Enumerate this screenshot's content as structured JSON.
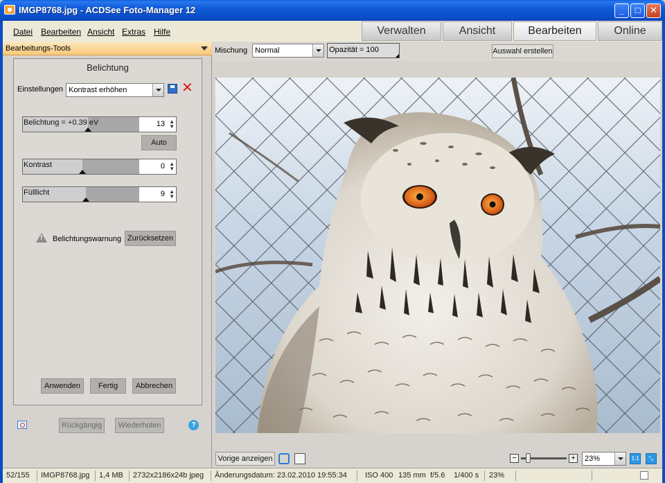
{
  "window": {
    "title": "IMGP8768.jpg - ACDSee Foto-Manager 12",
    "minimize": "_",
    "maximize": "□",
    "close": "✕"
  },
  "menu": [
    "Datei",
    "Bearbeiten",
    "Ansicht",
    "Extras",
    "Hilfe"
  ],
  "mode_tabs": [
    {
      "label": "Verwalten",
      "active": false
    },
    {
      "label": "Ansicht",
      "active": false
    },
    {
      "label": "Bearbeiten",
      "active": true
    },
    {
      "label": "Online",
      "active": false
    }
  ],
  "panel": {
    "header": "Bearbeitungs-Tools",
    "title": "Belichtung",
    "settings_label": "Einstellungen",
    "settings_value": "Kontrast erhöhen",
    "sliders": [
      {
        "label": "Belichtung = +0.39 eV",
        "value": "13",
        "level": 0.56
      },
      {
        "label": "Kontrast",
        "value": "0",
        "level": 0.51
      },
      {
        "label": "Fülllicht",
        "value": "9",
        "level": 0.54
      }
    ],
    "auto_button": "Auto",
    "warning_label": "Belichtungswarnung",
    "reset_button": "Zurücksetzen",
    "apply_button": "Anwenden",
    "done_button": "Fertig",
    "cancel_button": "Abbrechen",
    "undo_button": "Rückgängig",
    "redo_button": "Wiederholen",
    "help": "?"
  },
  "toolbar": {
    "blend_label": "Mischung",
    "blend_value": "Normal",
    "opacity": "Opazität = 100",
    "create_selection": "Auswahl erstellen"
  },
  "bottom_toolbar": {
    "show_previous": "Vorige anzeigen",
    "zoom": "23%",
    "zoom_level": 0.23,
    "actual_size": "1:1"
  },
  "statusbar": {
    "index": "52/155",
    "filename": "IMGP8768.jpg",
    "filesize": "1,4 MB",
    "dimensions": "2732x2186x24b jpeg",
    "modified": "Änderungsdatum: 23.02.2010 19:55:34",
    "iso": "ISO 400",
    "focal": "135 mm",
    "aperture": "f/5.6",
    "shutter": "1/400 s",
    "zoom": "23%"
  }
}
